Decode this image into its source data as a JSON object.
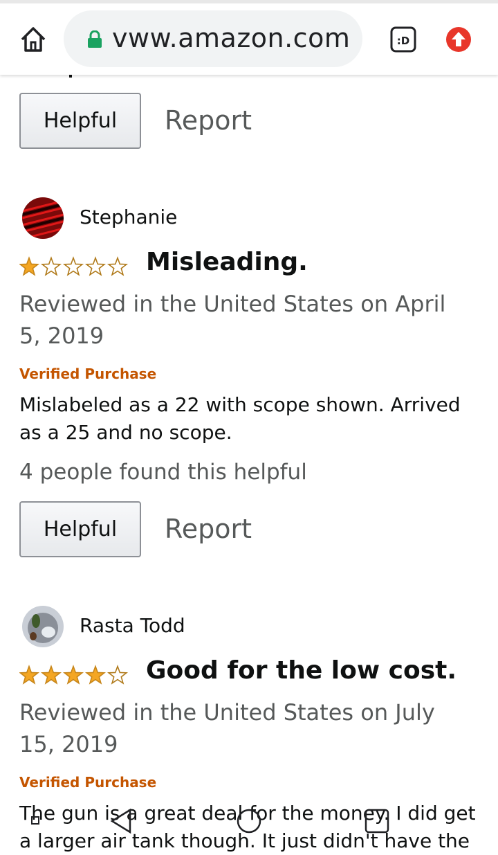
{
  "browser": {
    "url": "www.amazon.com",
    "url_display": "vww.amazon.com",
    "extension_label": ":D"
  },
  "colors": {
    "star": "#f4a623",
    "verified": "#c45500",
    "lock": "#1aa260",
    "update": "#e8362a"
  },
  "reviews": [
    {
      "helpful_label": "Helpful",
      "report_label": "Report"
    },
    {
      "reviewer": "Stephanie",
      "rating": 1,
      "title": "Misleading.",
      "reviewed": "Reviewed in the United States on April 5, 2019",
      "verified": "Verified Purchase",
      "body": "Mislabeled as a 22 with scope shown. Arrived as a 25 and no scope.",
      "helpful_count": "4 people found this helpful",
      "helpful_label": "Helpful",
      "report_label": "Report"
    },
    {
      "reviewer": "Rasta Todd",
      "rating": 4,
      "title": "Good for the low cost.",
      "reviewed": "Reviewed in the United States on July 15, 2019",
      "verified": "Verified Purchase",
      "body": "The gun is a great deal for the money. I did get a larger air tank though. It just didn't have the"
    }
  ]
}
